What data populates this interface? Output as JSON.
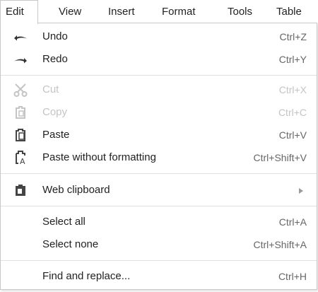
{
  "menubar": {
    "items": [
      {
        "label": "Edit"
      },
      {
        "label": "View"
      },
      {
        "label": "Insert"
      },
      {
        "label": "Format"
      },
      {
        "label": "Tools"
      },
      {
        "label": "Table"
      }
    ],
    "active": "Edit"
  },
  "edit_menu": {
    "undo": {
      "label": "Undo",
      "shortcut": "Ctrl+Z",
      "icon": "undo-icon"
    },
    "redo": {
      "label": "Redo",
      "shortcut": "Ctrl+Y",
      "icon": "redo-icon"
    },
    "cut": {
      "label": "Cut",
      "shortcut": "Ctrl+X",
      "icon": "scissors-icon",
      "disabled": true
    },
    "copy": {
      "label": "Copy",
      "shortcut": "Ctrl+C",
      "icon": "copy-icon",
      "disabled": true
    },
    "paste": {
      "label": "Paste",
      "shortcut": "Ctrl+V",
      "icon": "paste-icon"
    },
    "paste_without_formatting": {
      "label": "Paste without formatting",
      "shortcut": "Ctrl+Shift+V",
      "icon": "paste-plain-icon"
    },
    "web_clipboard": {
      "label": "Web clipboard",
      "icon": "clipboard-icon",
      "has_submenu": true
    },
    "select_all": {
      "label": "Select all",
      "shortcut": "Ctrl+A"
    },
    "select_none": {
      "label": "Select none",
      "shortcut": "Ctrl+Shift+A"
    },
    "find_replace": {
      "label": "Find and replace...",
      "shortcut": "Ctrl+H"
    }
  },
  "colors": {
    "text": "#222222",
    "shortcut_text": "#666666",
    "disabled_text": "#c4c4c4",
    "border": "#c8c8c8",
    "separator": "#e0e0e0"
  }
}
